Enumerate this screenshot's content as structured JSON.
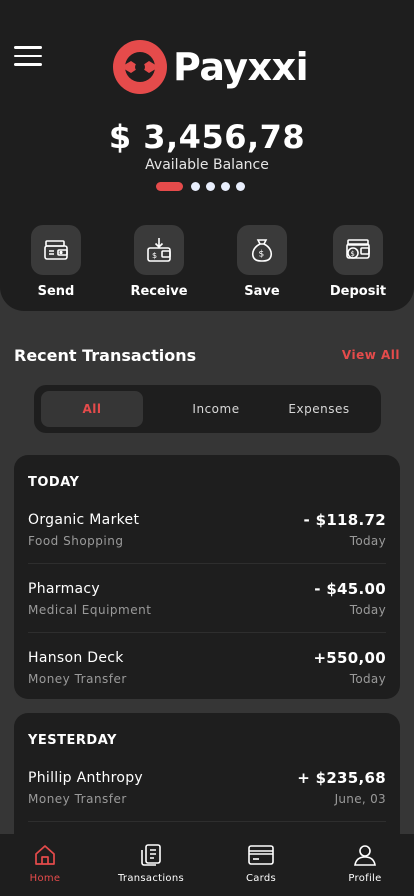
{
  "app": {
    "brand": "Payxxi",
    "brand_color": "#e54b4b"
  },
  "header": {
    "menu_icon": "hamburger-menu-icon",
    "balance": "$ 3,456,78",
    "balance_label": "Available Balance",
    "carousel": {
      "pages": 5,
      "active": 0
    }
  },
  "actions": [
    {
      "label": "Send",
      "icon": "wallet-send-icon"
    },
    {
      "label": "Receive",
      "icon": "wallet-receive-icon"
    },
    {
      "label": "Save",
      "icon": "money-bag-icon"
    },
    {
      "label": "Deposit",
      "icon": "wallet-deposit-icon"
    }
  ],
  "recent": {
    "title": "Recent Transactions",
    "view_all": "View All",
    "tabs": [
      "All",
      "Income",
      "Expenses"
    ],
    "active_tab": "All"
  },
  "groups": [
    {
      "heading": "TODAY",
      "items": [
        {
          "name": "Organic Market",
          "category": "Food Shopping",
          "amount": "- $118.72",
          "when": "Today"
        },
        {
          "name": "Pharmacy",
          "category": "Medical Equipment",
          "amount": "- $45.00",
          "when": "Today"
        },
        {
          "name": "Hanson Deck",
          "category": "Money Transfer",
          "amount": "+550,00",
          "when": "Today"
        }
      ]
    },
    {
      "heading": "YESTERDAY",
      "items": [
        {
          "name": "Phillip Anthropy",
          "category": "Money Transfer",
          "amount": "+ $235,68",
          "when": "June, 03"
        }
      ]
    }
  ],
  "bottom_nav": [
    {
      "label": "Home",
      "icon": "home-icon",
      "active": true
    },
    {
      "label": "Transactions",
      "icon": "receipt-icon",
      "active": false
    },
    {
      "label": "Cards",
      "icon": "credit-card-icon",
      "active": false
    },
    {
      "label": "Profile",
      "icon": "user-icon",
      "active": false
    }
  ]
}
